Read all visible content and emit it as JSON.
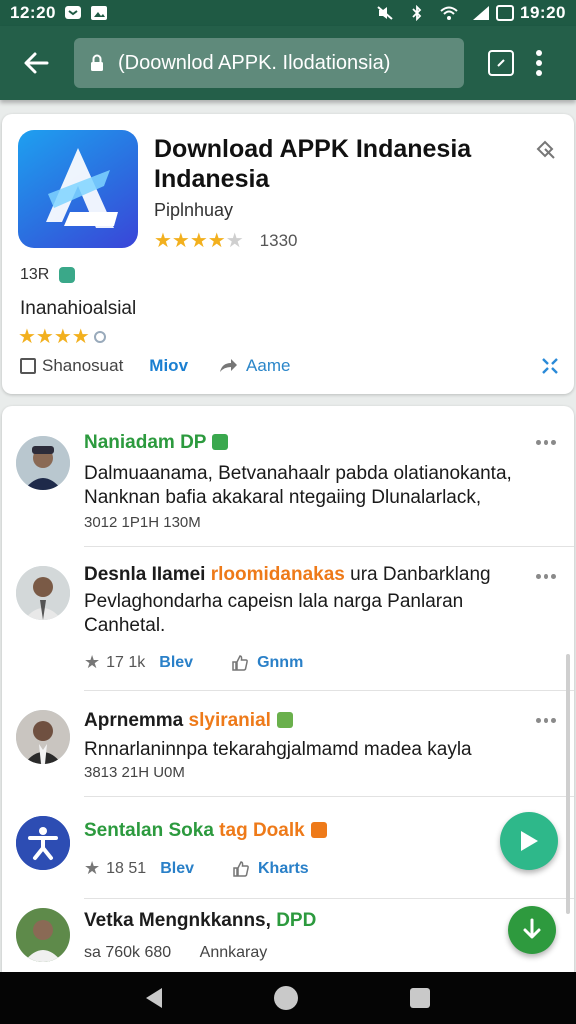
{
  "status_bar": {
    "time": "12:20",
    "clock_right": "19:20"
  },
  "app_bar": {
    "url": "(Doownlod APPK. Ilodationsia)"
  },
  "app": {
    "title": "Download APPK Indanesia Indanesia",
    "developer": "Piplnhuay",
    "rating_stars": 4,
    "rating_max": 5,
    "rating_count": "1330",
    "size": "13R",
    "category": "Inanahioalsial",
    "secondary_stars": 4,
    "actions": {
      "save": "Shanosuat",
      "more": "Miov",
      "share": "Aame"
    }
  },
  "reviews": [
    {
      "name": "Naniadam DP",
      "name_color": "#2c9a3e",
      "text": "Dalmuaanama, Betvanahaalr pabda olatianokanta, Nanknan bafia akakaral ntegaiing Dlunalarlack,",
      "timestamp": "3012 1P1H 130M"
    },
    {
      "name": "Desnla IIamei",
      "name_highlight": "rloomidanakas",
      "name_rest": "ura Danbarklang",
      "text": "Pevlaghondarha capeisn lala narga Panlaran Canhetal.",
      "likes": "17 1k",
      "reply": "Blev",
      "helpful": "Gnnm"
    },
    {
      "name": "Aprnemma",
      "name_highlight": "slyiranial",
      "text": "Rnnarlaninnpa tekarahgjalmamd madea kayla",
      "timestamp": "3813 21H U0M"
    },
    {
      "name": "Sentalan Soka",
      "name_highlight": "tag Doalk",
      "likes": "18 51",
      "reply": "Blev",
      "helpful": "Kharts"
    },
    {
      "name": "Vetka Mengnkkanns,",
      "name_highlight": "DPD",
      "meta": "sa 760k 680",
      "extra": "Annkaray"
    }
  ],
  "colors": {
    "app_bar": "#245f49",
    "status_bar": "#1f5a44",
    "accent_green": "#2c9a3e",
    "accent_orange": "#ee7a19",
    "link_blue": "#2a80c8",
    "star": "#f2b01e"
  }
}
